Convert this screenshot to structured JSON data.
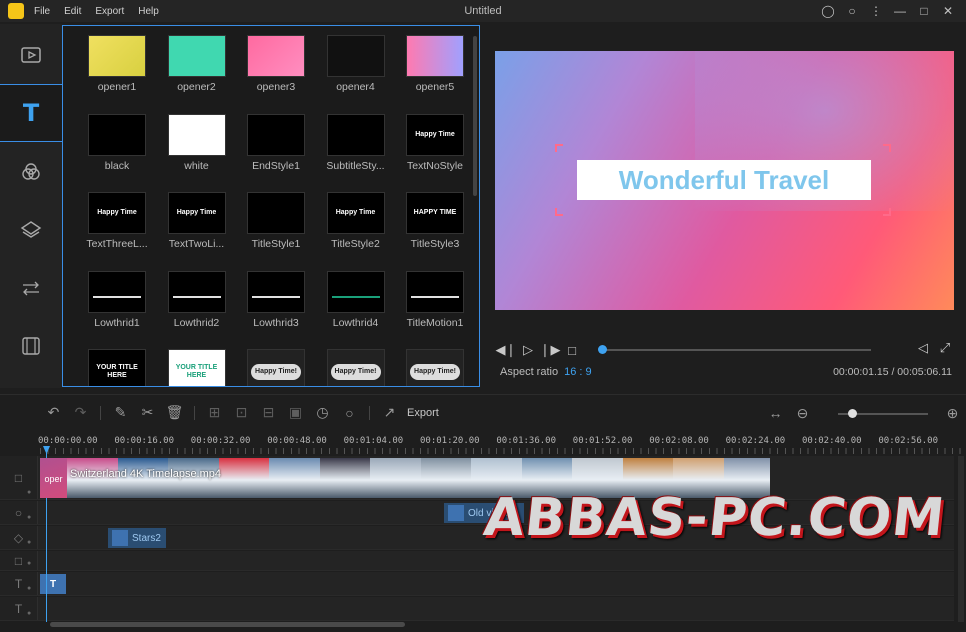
{
  "window": {
    "title": "Untitled"
  },
  "menu": [
    "File",
    "Edit",
    "Export",
    "Help"
  ],
  "library": {
    "items": [
      {
        "label": "opener1"
      },
      {
        "label": "opener2"
      },
      {
        "label": "opener3"
      },
      {
        "label": "opener4"
      },
      {
        "label": "opener5"
      },
      {
        "label": "black"
      },
      {
        "label": "white"
      },
      {
        "label": "EndStyle1"
      },
      {
        "label": "SubtitleSty..."
      },
      {
        "label": "TextNoStyle"
      },
      {
        "label": "TextThreeL..."
      },
      {
        "label": "TextTwoLi..."
      },
      {
        "label": "TitleStyle1"
      },
      {
        "label": "TitleStyle2"
      },
      {
        "label": "TitleStyle3"
      },
      {
        "label": "Lowthrid1"
      },
      {
        "label": "Lowthrid2"
      },
      {
        "label": "Lowthrid3"
      },
      {
        "label": "Lowthrid4"
      },
      {
        "label": "TitleMotion1"
      },
      {
        "label": ""
      },
      {
        "label": ""
      },
      {
        "label": ""
      },
      {
        "label": ""
      },
      {
        "label": ""
      }
    ],
    "thumb_text": {
      "t9": "Happy Time",
      "t10": "Happy Time",
      "t11": "Happy Time",
      "t13": "Happy Time",
      "t14": "HAPPY TIME",
      "t20": "YOUR TITLE HERE",
      "t21": "YOUR TITLE HERE",
      "t22": "Happy Time!",
      "t23": "Happy Time!",
      "t24": "Happy Time!"
    }
  },
  "preview": {
    "title_text": "Wonderful Travel",
    "aspect_label": "Aspect ratio",
    "aspect_value": "16 : 9",
    "timecode": "00:00:01.15 / 00:05:06.11",
    "progress_fraction": 0.01
  },
  "toolbar": {
    "export_label": "Export"
  },
  "ruler": {
    "ticks": [
      "00:00:00.00",
      "00:00:16.00",
      "00:00:32.00",
      "00:00:48.00",
      "00:01:04.00",
      "00:01:20.00",
      "00:01:36.00",
      "00:01:52.00",
      "00:02:08.00",
      "00:02:24.00",
      "00:02:40.00",
      "00:02:56.00"
    ]
  },
  "timeline": {
    "video_clip_label": "Switzerland 4K  Timelapse.mp4",
    "opener_chip": "oper",
    "old_video_label": "Old video",
    "stars_label": "Stars2",
    "text_chip": "T"
  },
  "watermark": "ABBAS-PC.COM",
  "colors": {
    "accent": "#3ea2f0",
    "panel_border": "#3a8ee6"
  }
}
